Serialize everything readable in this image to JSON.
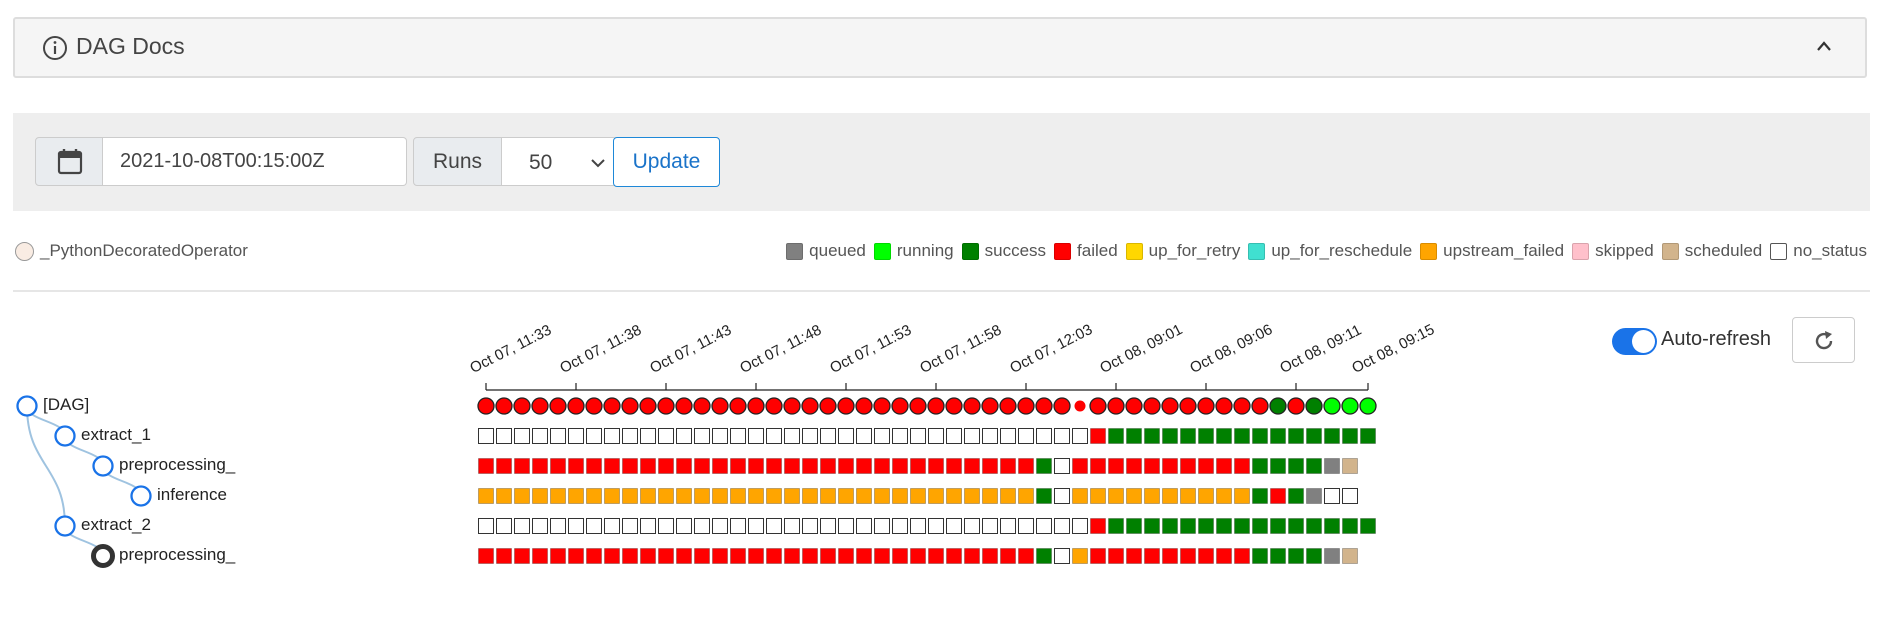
{
  "docs": {
    "title": "DAG Docs"
  },
  "controls": {
    "base_date": "2021-10-08T00:15:00Z",
    "runs_label": "Runs",
    "runs_value": "50",
    "update_label": "Update"
  },
  "operator_legend": {
    "label": "_PythonDecoratedOperator",
    "color": "#f9ece3"
  },
  "state_legend": [
    {
      "label": "queued",
      "color": "#808080"
    },
    {
      "label": "running",
      "color": "#00ff00"
    },
    {
      "label": "success",
      "color": "#008000"
    },
    {
      "label": "failed",
      "color": "#ff0000"
    },
    {
      "label": "up_for_retry",
      "color": "#ffd700"
    },
    {
      "label": "up_for_reschedule",
      "color": "#40e0d0"
    },
    {
      "label": "upstream_failed",
      "color": "#ffa500"
    },
    {
      "label": "skipped",
      "color": "#ffc0cb"
    },
    {
      "label": "scheduled",
      "color": "#d2b48c"
    },
    {
      "label": "no_status",
      "color": "#ffffff"
    }
  ],
  "auto_refresh": {
    "label": "Auto-refresh",
    "enabled": true
  },
  "tree": [
    {
      "label": "[DAG]",
      "depth": 0
    },
    {
      "label": "extract_1",
      "depth": 1
    },
    {
      "label": "preprocessing_",
      "depth": 2
    },
    {
      "label": "inference",
      "depth": 3
    },
    {
      "label": "extract_2",
      "depth": 1
    },
    {
      "label": "preprocessing_",
      "depth": 2,
      "selected": true
    }
  ],
  "time_ticks": [
    "Oct 07, 11:33",
    "Oct 07, 11:38",
    "Oct 07, 11:43",
    "Oct 07, 11:48",
    "Oct 07, 11:53",
    "Oct 07, 11:58",
    "Oct 07, 12:03",
    "Oct 08, 09:01",
    "Oct 08, 09:06",
    "Oct 08, 09:11",
    "Oct 08, 09:15"
  ],
  "state_colors": {
    "F": "#ff0000",
    "S": "#008000",
    "R": "#00ff00",
    "Q": "#808080",
    "U": "#ffa500",
    "C": "#d2b48c",
    "N": "#ffffff"
  },
  "grid_rows": [
    "FFFFFFFFFFFFFFFFFFFFFFFFFFFFFFFFFFFFFFFFFFFFSFSRRR",
    "NNNNNNNNNNNNNNNNNNNNNNNNNNNNNNNNNNFSSSSSSSSSSSSSSS",
    "FFFFFFFFFFFFFFFFFFFFFFFFFFFFFFFSNFFFFFFFFFFSSSSQC",
    "UUUUUUUUUUUUUUUUUUUUUUUUUUUUUUUSNUUUUUUUUUUSFSQNN",
    "NNNNNNNNNNNNNNNNNNNNNNNNNNNNNNNNNNFSSSSSSSSSSSSSSS",
    "FFFFFFFFFFFFFFFFFFFFFFFFFFFFFFFSNUFFFFFFFFFSSSSQC"
  ],
  "dag_row_special": {
    "index": 33,
    "state": "failed-small"
  }
}
